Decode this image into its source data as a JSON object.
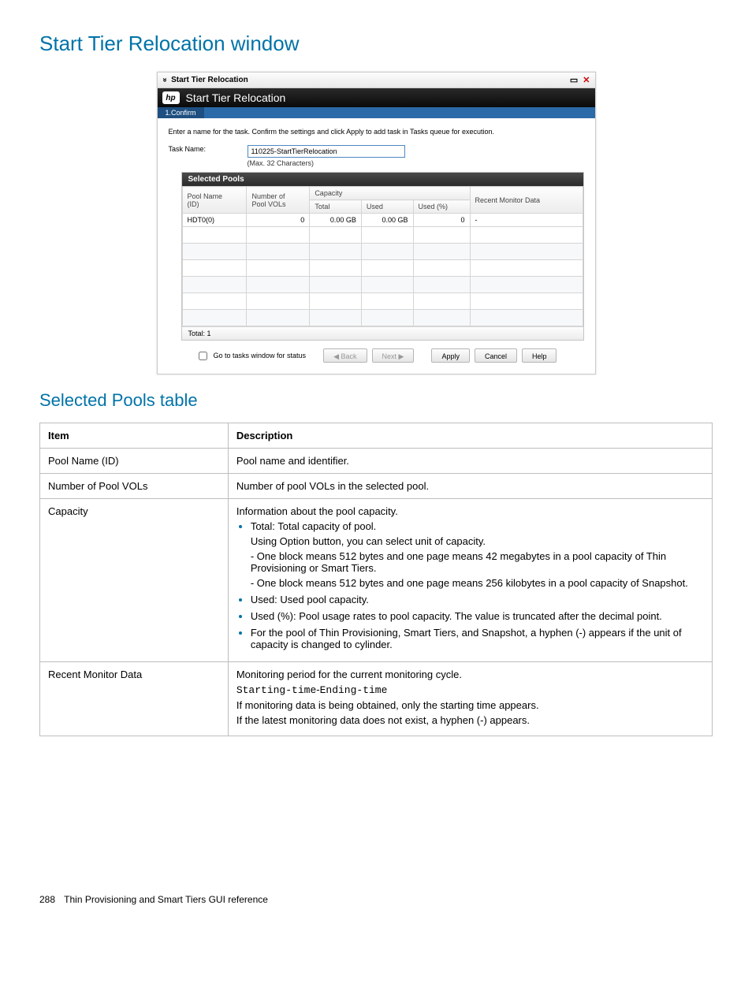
{
  "page_title": "Start Tier Relocation window",
  "window": {
    "titlebar": "Start Tier Relocation",
    "header": "Start Tier Relocation",
    "hp_label": "hp",
    "wizard_step": "1.Confirm",
    "instruction": "Enter a name for the task. Confirm the settings and click Apply to add task in Tasks queue for execution.",
    "task_name_label": "Task Name:",
    "task_name_value": "110225-StartTierRelocation",
    "task_name_hint": "(Max. 32 Characters)",
    "pools_header": "Selected Pools",
    "columns": {
      "pool_name_1": "Pool Name",
      "pool_name_2": "(ID)",
      "num_vols_1": "Number of",
      "num_vols_2": "Pool VOLs",
      "capacity": "Capacity",
      "total": "Total",
      "used": "Used",
      "used_pct": "Used (%)",
      "monitor": "Recent Monitor Data"
    },
    "row": {
      "pool_name": "HDT0(0)",
      "num_vols": "0",
      "total": "0.00 GB",
      "used": "0.00 GB",
      "used_pct": "0",
      "monitor": "-"
    },
    "total_footer": "Total: 1",
    "go_to_tasks": "Go to tasks window for status",
    "back": "Back",
    "next": "Next",
    "apply": "Apply",
    "cancel": "Cancel",
    "help": "Help"
  },
  "section_title": "Selected Pools table",
  "desc_headers": {
    "item": "Item",
    "description": "Description"
  },
  "rows": {
    "r1_item": "Pool Name (ID)",
    "r1_desc": "Pool name and identifier.",
    "r2_item": "Number of Pool VOLs",
    "r2_desc": "Number of pool VOLs in the selected pool.",
    "r3_item": "Capacity",
    "r3_intro": "Information about the pool capacity.",
    "r3_b1": "Total: Total capacity of pool.",
    "r3_b1_p1": "Using Option button, you can select unit of capacity.",
    "r3_b1_p2": "- One block means 512 bytes and one page means 42 megabytes in a pool capacity of Thin Provisioning or Smart Tiers.",
    "r3_b1_p3": "- One block means 512 bytes and one page means 256 kilobytes in a pool capacity of Snapshot.",
    "r3_b2": "Used: Used pool capacity.",
    "r3_b3": "Used (%): Pool usage rates to pool capacity. The value is truncated after the decimal point.",
    "r3_b4": "For the pool of Thin Provisioning, Smart Tiers, and Snapshot, a hyphen (-) appears if the unit of capacity is changed to cylinder.",
    "r4_item": "Recent Monitor Data",
    "r4_p1": "Monitoring period for the current monitoring cycle.",
    "r4_code_a": "Starting-time",
    "r4_code_sep": "-",
    "r4_code_b": "Ending-time",
    "r4_p2": "If monitoring data is being obtained, only the starting time appears.",
    "r4_p3": "If the latest monitoring data does not exist, a hyphen (-) appears."
  },
  "footer": {
    "page_number": "288",
    "chapter": "Thin Provisioning and Smart Tiers GUI reference"
  }
}
